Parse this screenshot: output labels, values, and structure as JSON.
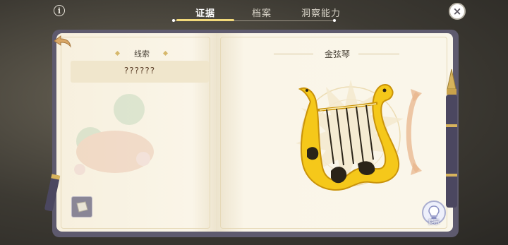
{
  "top_bar": {
    "info_glyph": "i",
    "tabs": [
      {
        "label": "证据",
        "active": true
      },
      {
        "label": "档案",
        "active": false
      },
      {
        "label": "洞察能力",
        "active": false
      }
    ],
    "close_glyph": "×"
  },
  "left_page": {
    "section_title": "线索",
    "clue_value": "??????"
  },
  "right_page": {
    "item_name": "金弦琴"
  },
  "hint": {
    "label": "提示"
  },
  "colors": {
    "accent": "#f2d97a",
    "book_cover": "#5e5a6e",
    "page": "#faf5e8",
    "harp_gold": "#f5c81a",
    "harp_dark": "#2b2418"
  }
}
